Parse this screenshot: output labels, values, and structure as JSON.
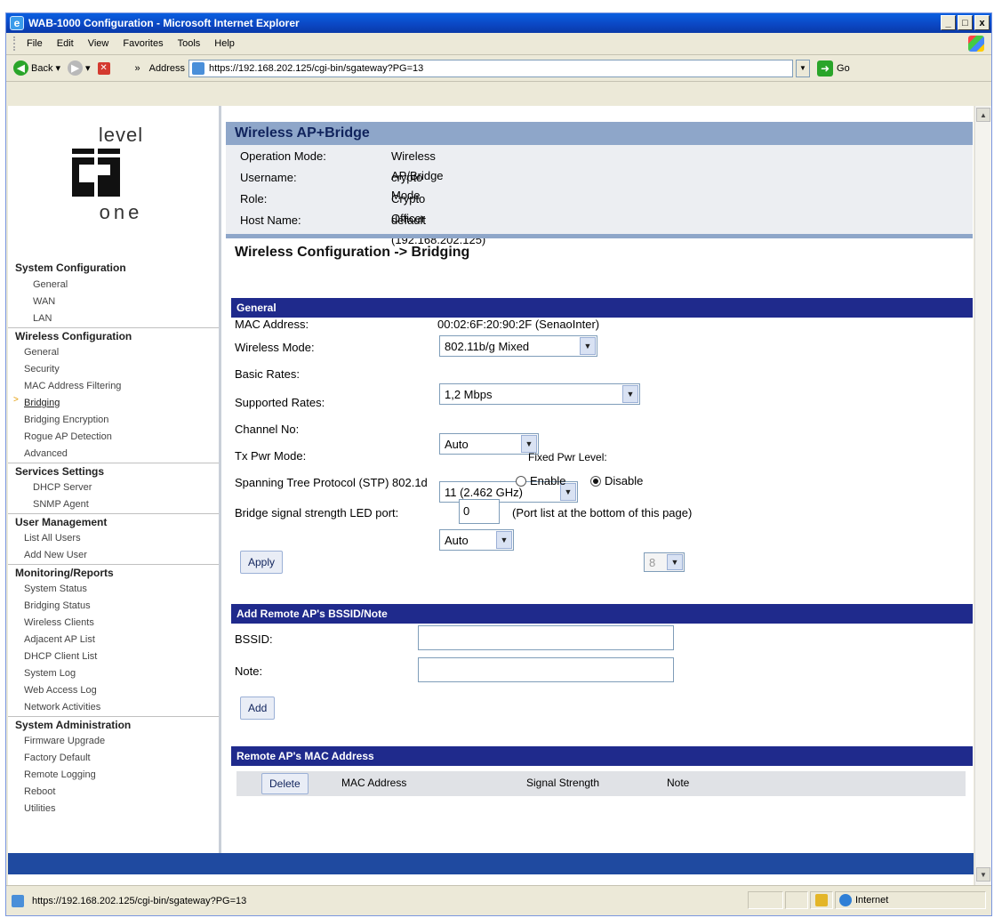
{
  "window": {
    "title": "WAB-1000 Configuration - Microsoft Internet Explorer",
    "controls": [
      "_",
      "□",
      "x"
    ]
  },
  "menu": [
    "File",
    "Edit",
    "View",
    "Favorites",
    "Tools",
    "Help"
  ],
  "toolbar": {
    "back_label": "Back",
    "chevron": "»",
    "address_label": "Address",
    "url": "https://192.168.202.125/cgi-bin/sgateway?PG=13",
    "go_label": "Go"
  },
  "logo": {
    "top": "level",
    "bottom": "one"
  },
  "nav": {
    "sections": [
      {
        "title": "System Configuration",
        "items": [
          "General",
          "WAN",
          "LAN"
        ]
      },
      {
        "title": "Wireless Configuration",
        "items": [
          "General",
          "Security",
          "MAC Address Filtering",
          "Bridging",
          "Bridging Encryption",
          "Rogue AP Detection",
          "Advanced"
        ]
      },
      {
        "title": "Services Settings",
        "items": [
          "DHCP Server",
          "SNMP Agent"
        ]
      },
      {
        "title": "User Management",
        "items": [
          "List All Users",
          "Add New User"
        ]
      },
      {
        "title": "Monitoring/Reports",
        "items": [
          "System Status",
          "Bridging Status",
          "Wireless Clients",
          "Adjacent AP List",
          "DHCP Client List",
          "System Log",
          "Web Access Log",
          "Network Activities"
        ]
      },
      {
        "title": "System Administration",
        "items": [
          "Firmware Upgrade",
          "Factory Default",
          "Remote Logging",
          "Reboot",
          "Utilities"
        ]
      }
    ],
    "active_marker": ">"
  },
  "header": {
    "title": "Wireless AP+Bridge",
    "rows": [
      {
        "label": "Operation Mode:",
        "value": "Wireless AP/Bridge Mode"
      },
      {
        "label": "Username:",
        "value": "crypto"
      },
      {
        "label": "Role:",
        "value": "Crypto Officer"
      },
      {
        "label": "Host Name:",
        "value": "default (192.168.202.125)"
      }
    ]
  },
  "page_heading": "Wireless Configuration -> Bridging",
  "general": {
    "section_title": "General",
    "mac_label": "MAC Address:",
    "mac_value": "00:02:6F:20:90:2F (SenaoInter)",
    "wireless_mode_label": "Wireless Mode:",
    "wireless_mode_value": "802.11b/g Mixed",
    "basic_rates_label": "Basic Rates:",
    "basic_rates_value": "1,2 Mbps",
    "supported_rates_label": "Supported Rates:",
    "supported_rates_value": "Auto",
    "channel_label": "Channel No:",
    "channel_value": "11 (2.462 GHz)",
    "txpwr_label": "Tx Pwr Mode:",
    "txpwr_value": "Auto",
    "fixed_pwr_label": "Fixed Pwr Level:",
    "fixed_pwr_value": "8",
    "stp_label": "Spanning Tree Protocol (STP) 802.1d",
    "stp_enable": "Enable",
    "stp_disable": "Disable",
    "led_label": "Bridge signal strength LED port:",
    "led_value": "0",
    "led_hint": "(Port list at the bottom of this page)",
    "apply_label": "Apply"
  },
  "remote_add": {
    "section_title": "Add Remote AP's BSSID/Note",
    "bssid_label": "BSSID:",
    "note_label": "Note:",
    "add_label": "Add"
  },
  "remote_list": {
    "section_title": "Remote AP's MAC Address",
    "columns": [
      "Delete",
      "MAC Address",
      "Signal Strength",
      "Note"
    ]
  },
  "status": {
    "text": "https://192.168.202.125/cgi-bin/sgateway?PG=13",
    "zone": "Internet"
  }
}
